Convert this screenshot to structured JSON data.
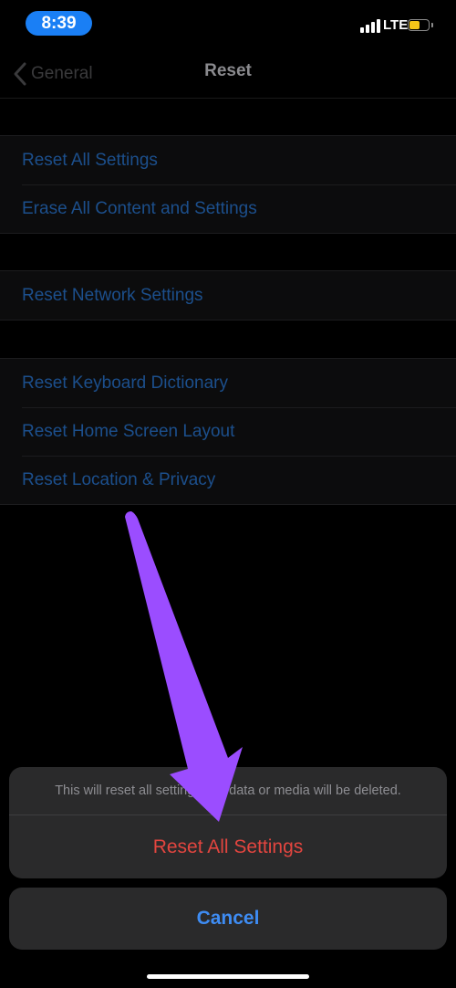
{
  "status_bar": {
    "time": "8:39",
    "network": "LTE",
    "battery_level": 0.6,
    "colors": {
      "time_pill": "#1a7ff5",
      "battery": "#f5c518"
    }
  },
  "nav": {
    "back_label": "General",
    "back_icon": "chevron-left-icon",
    "title": "Reset"
  },
  "groups": [
    {
      "items": [
        "Reset All Settings",
        "Erase All Content and Settings"
      ]
    },
    {
      "items": [
        "Reset Network Settings"
      ]
    },
    {
      "items": [
        "Reset Keyboard Dictionary",
        "Reset Home Screen Layout",
        "Reset Location & Privacy"
      ]
    }
  ],
  "action_sheet": {
    "message": "This will reset all settings. No data or media will be deleted.",
    "destructive_label": "Reset All Settings",
    "cancel_label": "Cancel",
    "colors": {
      "destructive": "#e2453f",
      "cancel": "#3e8cf3"
    }
  },
  "annotation": {
    "type": "arrow",
    "color": "#9b4dff"
  }
}
